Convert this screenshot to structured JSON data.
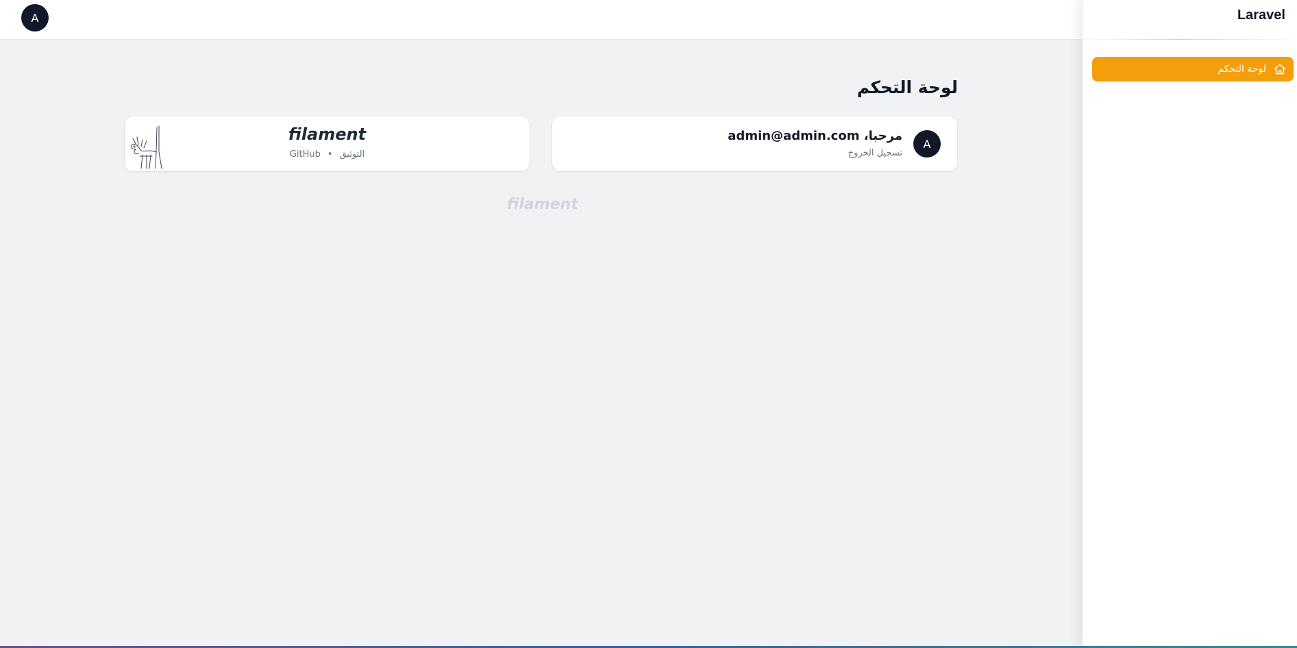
{
  "topbar": {
    "avatar_initial": "A"
  },
  "sidebar": {
    "brand": "Laravel",
    "items": [
      {
        "label": "لوحة التحكم",
        "icon": "home-icon",
        "active": true
      }
    ],
    "accent_color": "#f59e0b"
  },
  "main": {
    "title": "لوحة التحكم",
    "account_widget": {
      "avatar_initial": "A",
      "welcome": "مرحبا، admin@admin.com",
      "logout_label": "تسجيل الخروج"
    },
    "filament_widget": {
      "logo_text": "filament",
      "docs_label": "التوثيق",
      "separator": "•",
      "github_label": "GitHub"
    },
    "footer_logo": "filament"
  }
}
